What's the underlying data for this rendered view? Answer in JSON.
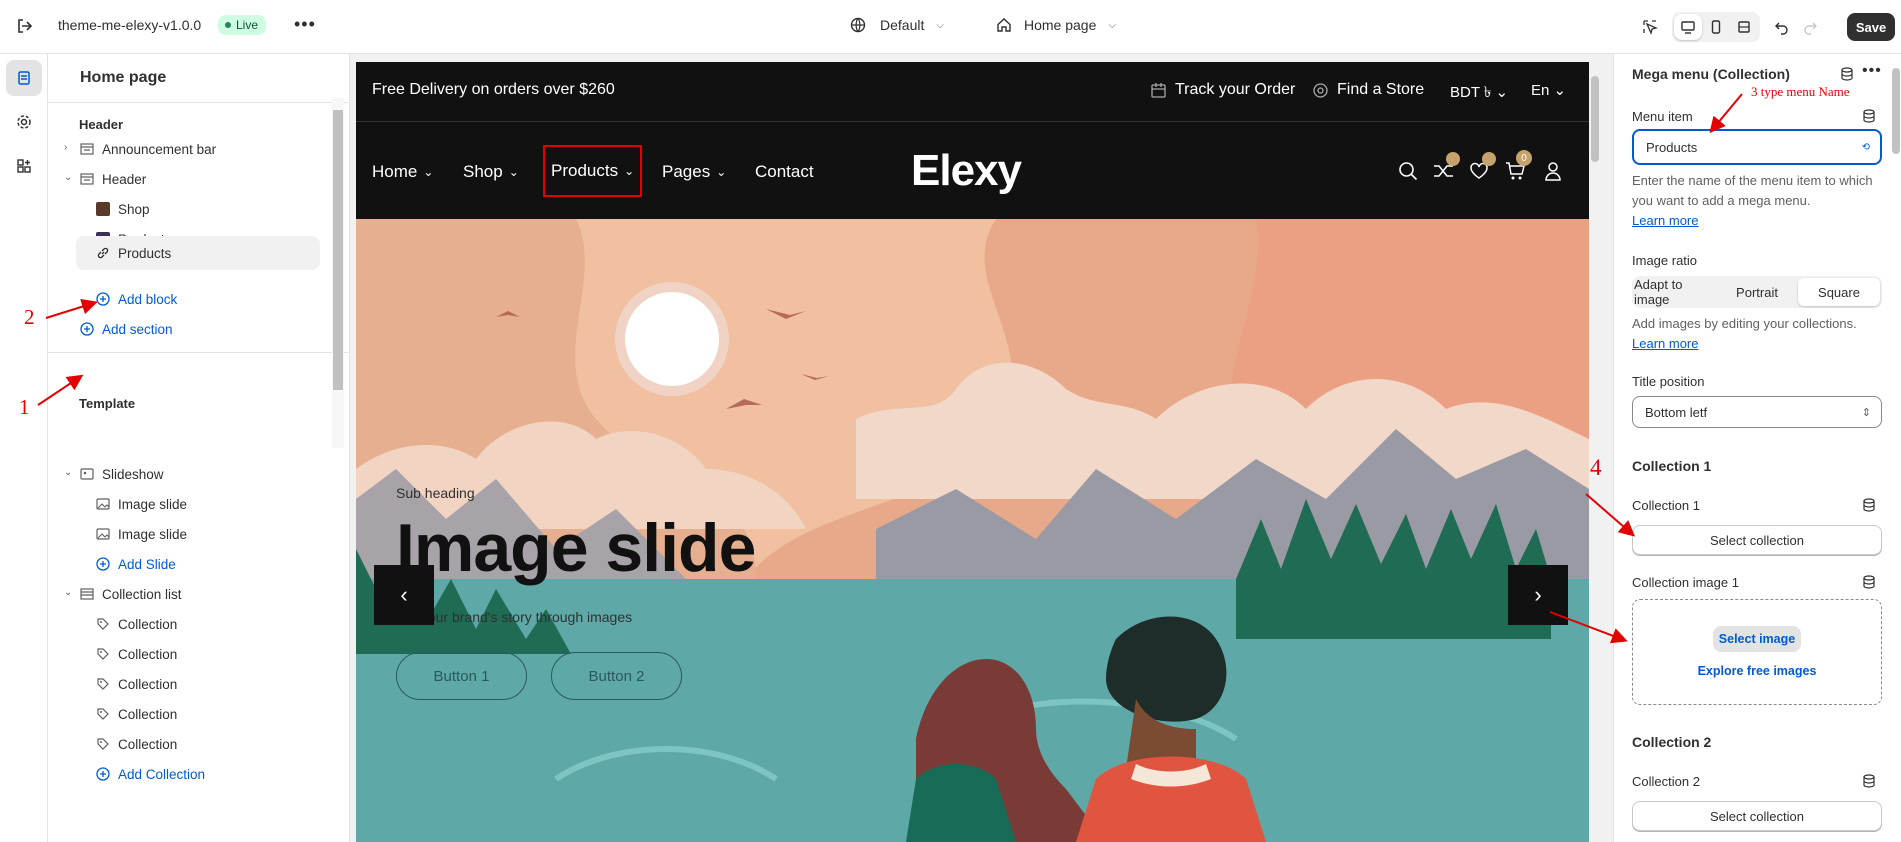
{
  "topbar": {
    "theme_name": "theme-me-elexy-v1.0.0",
    "live_badge": "Live",
    "more": "•••",
    "theme_selector": "Default",
    "page_selector": "Home page",
    "save_label": "Save"
  },
  "sidebar": {
    "title": "Home page",
    "header_section": "Header",
    "header_items": [
      {
        "label": "Announcement bar"
      },
      {
        "label": "Header"
      },
      {
        "label": "Shop"
      },
      {
        "label": "Products"
      },
      {
        "label": "Products"
      },
      {
        "label": "Add block"
      }
    ],
    "add_section": "Add section",
    "template_section": "Template",
    "template_items": [
      {
        "label": "Slideshow"
      },
      {
        "label": "Image slide"
      },
      {
        "label": "Image slide"
      },
      {
        "label": "Add Slide"
      },
      {
        "label": "Collection list"
      },
      {
        "label": "Collection"
      },
      {
        "label": "Collection"
      },
      {
        "label": "Collection"
      },
      {
        "label": "Collection"
      },
      {
        "label": "Collection"
      },
      {
        "label": "Add Collection"
      }
    ]
  },
  "preview": {
    "announcement": "Free Delivery on orders over $260",
    "track_order": "Track your Order",
    "find_store": "Find a Store",
    "currency": "BDT ৳",
    "language": "En",
    "nav": [
      "Home",
      "Shop",
      "Products",
      "Pages",
      "Contact"
    ],
    "logo": "Elexy",
    "cart_count": "0",
    "hero": {
      "subheading": "Sub heading",
      "heading": "Image slide",
      "text": "Tell your brand's story through images",
      "button1": "Button 1",
      "button2": "Button 2"
    }
  },
  "panel": {
    "title": "Mega menu (Collection)",
    "menu_item_label": "Menu item",
    "menu_item_value": "Products",
    "menu_item_help": "Enter the name of the menu item to which you want to add a mega menu.",
    "learn_more": "Learn more",
    "image_ratio_label": "Image ratio",
    "ratio_options": [
      "Adapt to image",
      "Portrait",
      "Square"
    ],
    "ratio_help": "Add images by editing your collections.",
    "title_position_label": "Title position",
    "title_position_value": "Bottom letf",
    "collection1_heading": "Collection 1",
    "collection1_label": "Collection 1",
    "select_collection": "Select collection",
    "collection_image1_label": "Collection image 1",
    "select_image": "Select image",
    "explore_images": "Explore free images",
    "collection2_heading": "Collection 2",
    "collection2_label": "Collection 2"
  },
  "annotations": {
    "a1": "1",
    "a2": "2",
    "a3": "3 type menu Name",
    "a4": "4"
  },
  "colors": {
    "accent": "#005bd3",
    "annotation": "#e30000",
    "store_bg": "#111111"
  }
}
